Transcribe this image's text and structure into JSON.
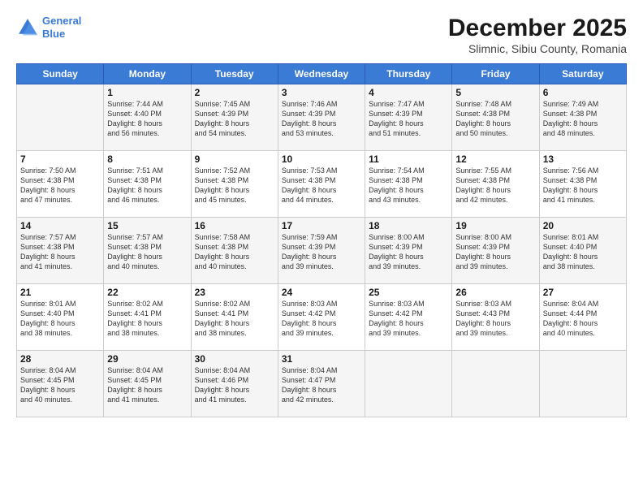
{
  "logo": {
    "line1": "General",
    "line2": "Blue"
  },
  "title": "December 2025",
  "subtitle": "Slimnic, Sibiu County, Romania",
  "days_header": [
    "Sunday",
    "Monday",
    "Tuesday",
    "Wednesday",
    "Thursday",
    "Friday",
    "Saturday"
  ],
  "weeks": [
    [
      {
        "num": "",
        "sunrise": "",
        "sunset": "",
        "daylight": ""
      },
      {
        "num": "1",
        "sunrise": "Sunrise: 7:44 AM",
        "sunset": "Sunset: 4:40 PM",
        "daylight": "Daylight: 8 hours and 56 minutes."
      },
      {
        "num": "2",
        "sunrise": "Sunrise: 7:45 AM",
        "sunset": "Sunset: 4:39 PM",
        "daylight": "Daylight: 8 hours and 54 minutes."
      },
      {
        "num": "3",
        "sunrise": "Sunrise: 7:46 AM",
        "sunset": "Sunset: 4:39 PM",
        "daylight": "Daylight: 8 hours and 53 minutes."
      },
      {
        "num": "4",
        "sunrise": "Sunrise: 7:47 AM",
        "sunset": "Sunset: 4:39 PM",
        "daylight": "Daylight: 8 hours and 51 minutes."
      },
      {
        "num": "5",
        "sunrise": "Sunrise: 7:48 AM",
        "sunset": "Sunset: 4:38 PM",
        "daylight": "Daylight: 8 hours and 50 minutes."
      },
      {
        "num": "6",
        "sunrise": "Sunrise: 7:49 AM",
        "sunset": "Sunset: 4:38 PM",
        "daylight": "Daylight: 8 hours and 48 minutes."
      }
    ],
    [
      {
        "num": "7",
        "sunrise": "Sunrise: 7:50 AM",
        "sunset": "Sunset: 4:38 PM",
        "daylight": "Daylight: 8 hours and 47 minutes."
      },
      {
        "num": "8",
        "sunrise": "Sunrise: 7:51 AM",
        "sunset": "Sunset: 4:38 PM",
        "daylight": "Daylight: 8 hours and 46 minutes."
      },
      {
        "num": "9",
        "sunrise": "Sunrise: 7:52 AM",
        "sunset": "Sunset: 4:38 PM",
        "daylight": "Daylight: 8 hours and 45 minutes."
      },
      {
        "num": "10",
        "sunrise": "Sunrise: 7:53 AM",
        "sunset": "Sunset: 4:38 PM",
        "daylight": "Daylight: 8 hours and 44 minutes."
      },
      {
        "num": "11",
        "sunrise": "Sunrise: 7:54 AM",
        "sunset": "Sunset: 4:38 PM",
        "daylight": "Daylight: 8 hours and 43 minutes."
      },
      {
        "num": "12",
        "sunrise": "Sunrise: 7:55 AM",
        "sunset": "Sunset: 4:38 PM",
        "daylight": "Daylight: 8 hours and 42 minutes."
      },
      {
        "num": "13",
        "sunrise": "Sunrise: 7:56 AM",
        "sunset": "Sunset: 4:38 PM",
        "daylight": "Daylight: 8 hours and 41 minutes."
      }
    ],
    [
      {
        "num": "14",
        "sunrise": "Sunrise: 7:57 AM",
        "sunset": "Sunset: 4:38 PM",
        "daylight": "Daylight: 8 hours and 41 minutes."
      },
      {
        "num": "15",
        "sunrise": "Sunrise: 7:57 AM",
        "sunset": "Sunset: 4:38 PM",
        "daylight": "Daylight: 8 hours and 40 minutes."
      },
      {
        "num": "16",
        "sunrise": "Sunrise: 7:58 AM",
        "sunset": "Sunset: 4:38 PM",
        "daylight": "Daylight: 8 hours and 40 minutes."
      },
      {
        "num": "17",
        "sunrise": "Sunrise: 7:59 AM",
        "sunset": "Sunset: 4:39 PM",
        "daylight": "Daylight: 8 hours and 39 minutes."
      },
      {
        "num": "18",
        "sunrise": "Sunrise: 8:00 AM",
        "sunset": "Sunset: 4:39 PM",
        "daylight": "Daylight: 8 hours and 39 minutes."
      },
      {
        "num": "19",
        "sunrise": "Sunrise: 8:00 AM",
        "sunset": "Sunset: 4:39 PM",
        "daylight": "Daylight: 8 hours and 39 minutes."
      },
      {
        "num": "20",
        "sunrise": "Sunrise: 8:01 AM",
        "sunset": "Sunset: 4:40 PM",
        "daylight": "Daylight: 8 hours and 38 minutes."
      }
    ],
    [
      {
        "num": "21",
        "sunrise": "Sunrise: 8:01 AM",
        "sunset": "Sunset: 4:40 PM",
        "daylight": "Daylight: 8 hours and 38 minutes."
      },
      {
        "num": "22",
        "sunrise": "Sunrise: 8:02 AM",
        "sunset": "Sunset: 4:41 PM",
        "daylight": "Daylight: 8 hours and 38 minutes."
      },
      {
        "num": "23",
        "sunrise": "Sunrise: 8:02 AM",
        "sunset": "Sunset: 4:41 PM",
        "daylight": "Daylight: 8 hours and 38 minutes."
      },
      {
        "num": "24",
        "sunrise": "Sunrise: 8:03 AM",
        "sunset": "Sunset: 4:42 PM",
        "daylight": "Daylight: 8 hours and 39 minutes."
      },
      {
        "num": "25",
        "sunrise": "Sunrise: 8:03 AM",
        "sunset": "Sunset: 4:42 PM",
        "daylight": "Daylight: 8 hours and 39 minutes."
      },
      {
        "num": "26",
        "sunrise": "Sunrise: 8:03 AM",
        "sunset": "Sunset: 4:43 PM",
        "daylight": "Daylight: 8 hours and 39 minutes."
      },
      {
        "num": "27",
        "sunrise": "Sunrise: 8:04 AM",
        "sunset": "Sunset: 4:44 PM",
        "daylight": "Daylight: 8 hours and 40 minutes."
      }
    ],
    [
      {
        "num": "28",
        "sunrise": "Sunrise: 8:04 AM",
        "sunset": "Sunset: 4:45 PM",
        "daylight": "Daylight: 8 hours and 40 minutes."
      },
      {
        "num": "29",
        "sunrise": "Sunrise: 8:04 AM",
        "sunset": "Sunset: 4:45 PM",
        "daylight": "Daylight: 8 hours and 41 minutes."
      },
      {
        "num": "30",
        "sunrise": "Sunrise: 8:04 AM",
        "sunset": "Sunset: 4:46 PM",
        "daylight": "Daylight: 8 hours and 41 minutes."
      },
      {
        "num": "31",
        "sunrise": "Sunrise: 8:04 AM",
        "sunset": "Sunset: 4:47 PM",
        "daylight": "Daylight: 8 hours and 42 minutes."
      },
      {
        "num": "",
        "sunrise": "",
        "sunset": "",
        "daylight": ""
      },
      {
        "num": "",
        "sunrise": "",
        "sunset": "",
        "daylight": ""
      },
      {
        "num": "",
        "sunrise": "",
        "sunset": "",
        "daylight": ""
      }
    ]
  ]
}
